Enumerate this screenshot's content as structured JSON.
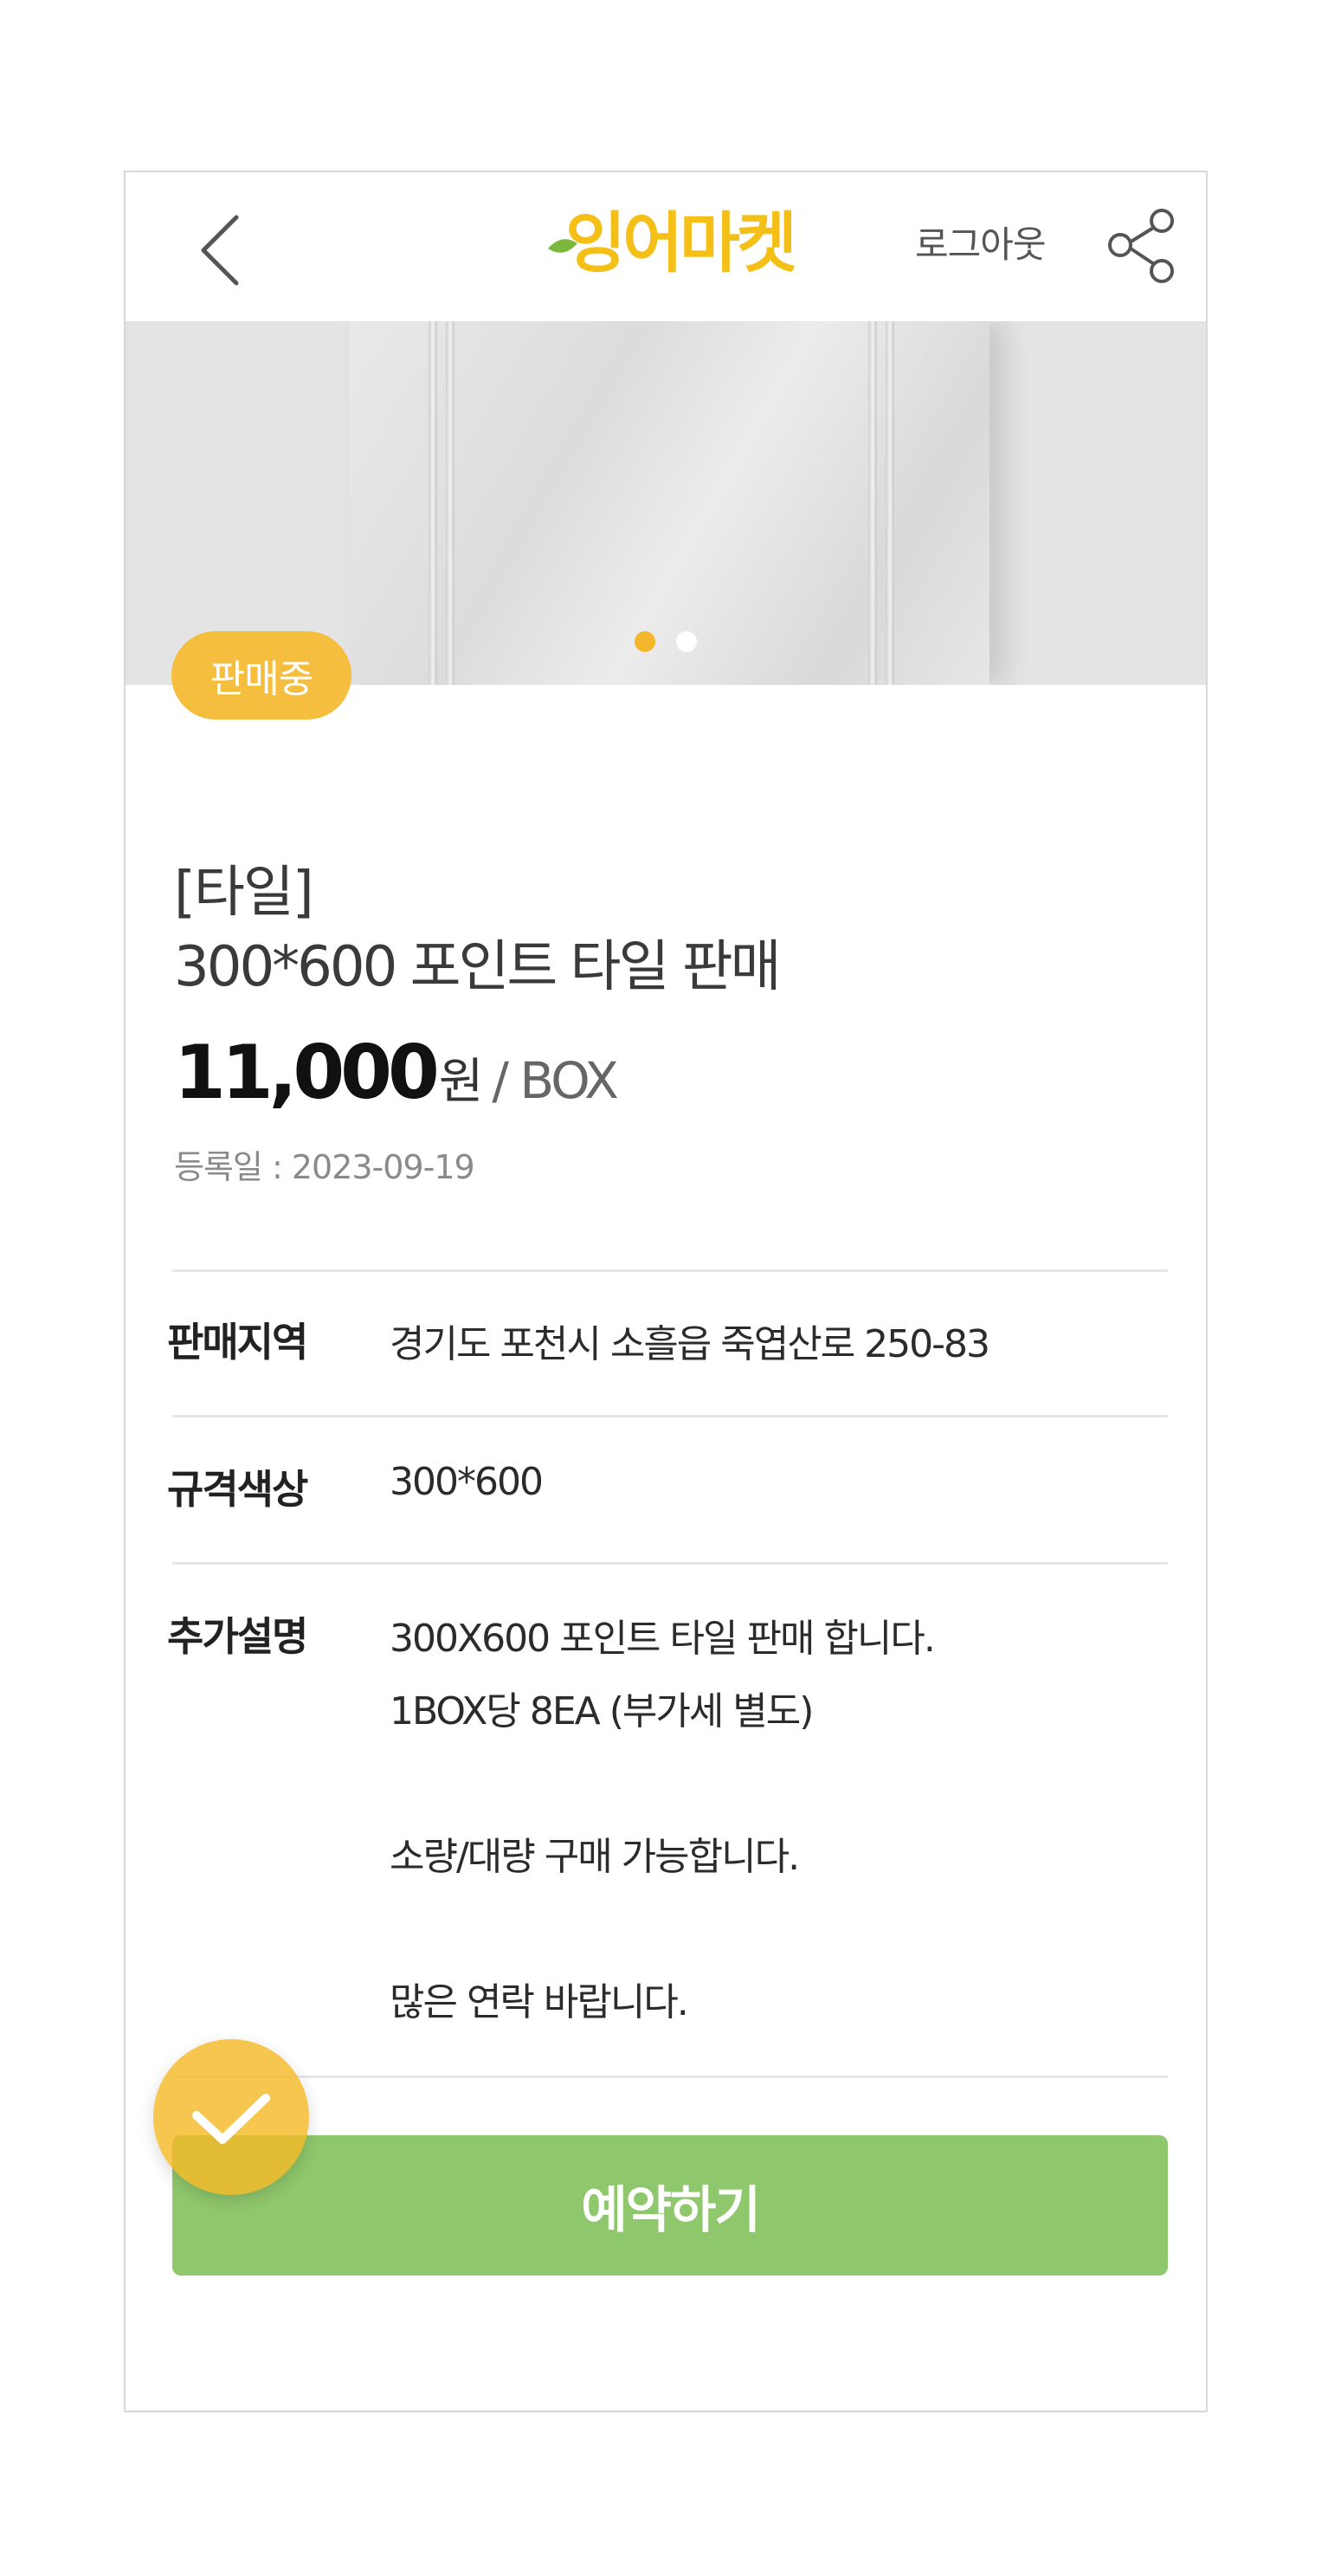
{
  "header": {
    "logo_text": "잉어마켓",
    "logout_label": "로그아웃"
  },
  "icons": {
    "back": "chevron-left-icon",
    "share": "share-icon",
    "fab": "checkmark-icon"
  },
  "colors": {
    "accent_yellow": "#f6be3e",
    "logo_green": "#79b83a",
    "button_green": "#8fc76c"
  },
  "gallery": {
    "total_slides": 2,
    "active_slide": 1
  },
  "product": {
    "status_badge": "판매중",
    "category": "[타일]",
    "title": "300*600 포인트 타일 판매",
    "price": "11,000",
    "currency": "원",
    "unit": "/ BOX",
    "reg_date": "등록일 : 2023-09-19"
  },
  "info": {
    "region_label": "판매지역",
    "region_value": "경기도 포천시 소흘읍 죽엽산로 250-83",
    "spec_label": "규격색상",
    "spec_value": "300*600",
    "desc_label": "추가설명",
    "desc_lines": [
      "300X600 포인트 타일 판매 합니다.",
      "1BOX당 8EA (부가세 별도)",
      "소량/대량 구매 가능합니다.",
      "많은 연락 바랍니다."
    ]
  },
  "actions": {
    "reserve_label": "예약하기"
  }
}
